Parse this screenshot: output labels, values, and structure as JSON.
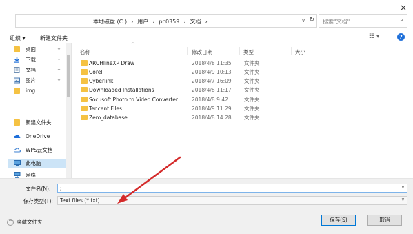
{
  "window": {
    "close_label": "×"
  },
  "address_bar": {
    "crumbs": [
      "本地磁盘 (C:)",
      "›",
      "用户",
      "›",
      "pc0359",
      "›",
      "文档",
      "›"
    ],
    "dropdown": "∨",
    "refresh": "↻"
  },
  "search": {
    "placeholder": "搜索\"文档\"",
    "icon": "⌕"
  },
  "toolbar": {
    "organize": "组织 ▾",
    "new_folder": "新建文件夹",
    "view": "☷ ▾",
    "help": "?"
  },
  "sidebar": {
    "items": [
      {
        "label": "桌面",
        "icon": "folder-icon",
        "pin": "✦"
      },
      {
        "label": "下载",
        "icon": "download-icon",
        "pin": "✦"
      },
      {
        "label": "文档",
        "icon": "document-icon",
        "pin": "✦"
      },
      {
        "label": "图片",
        "icon": "picture-icon",
        "pin": "✦"
      },
      {
        "label": "img",
        "icon": "folder-icon",
        "pin": ""
      },
      {
        "label": "新建文件夹",
        "icon": "folder-icon",
        "pin": ""
      },
      {
        "label": "OneDrive",
        "icon": "cloud-icon",
        "pin": ""
      },
      {
        "label": "WPS云文档",
        "icon": "cloud-icon",
        "pin": ""
      },
      {
        "label": "此电脑",
        "icon": "computer-icon",
        "pin": ""
      },
      {
        "label": "网络",
        "icon": "network-icon",
        "pin": ""
      }
    ],
    "selected_index": 8
  },
  "columns": {
    "name": "名称",
    "date": "修改日期",
    "type": "类型",
    "size": "大小",
    "sort_indicator": "^"
  },
  "files": [
    {
      "name": "ARCHlineXP Draw",
      "date": "2018/4/8 11:35",
      "type": "文件夹"
    },
    {
      "name": "Corel",
      "date": "2018/4/9 10:13",
      "type": "文件夹"
    },
    {
      "name": "Cyberlink",
      "date": "2018/4/7 16:09",
      "type": "文件夹"
    },
    {
      "name": "Downloaded Installations",
      "date": "2018/4/8 11:17",
      "type": "文件夹"
    },
    {
      "name": "Socusoft Photo to Video Converter",
      "date": "2018/4/8 9:42",
      "type": "文件夹"
    },
    {
      "name": "Tencent Files",
      "date": "2018/4/9 11:29",
      "type": "文件夹"
    },
    {
      "name": "Zero_database",
      "date": "2018/4/8 14:28",
      "type": "文件夹"
    }
  ],
  "form": {
    "filename_label": "文件名(N):",
    "filename_value": ";",
    "filetype_label": "保存类型(T):",
    "filetype_value": "Text files (*.txt)",
    "dropdown": "∨"
  },
  "footer": {
    "hide_folders": "隐藏文件夹",
    "hide_icon": "^",
    "save": "保存(S)",
    "cancel": "取消"
  },
  "colors": {
    "accent": "#0078d7",
    "folder": "#f5c243",
    "arrow": "#d42a2a",
    "selected": "#cce4f7"
  }
}
